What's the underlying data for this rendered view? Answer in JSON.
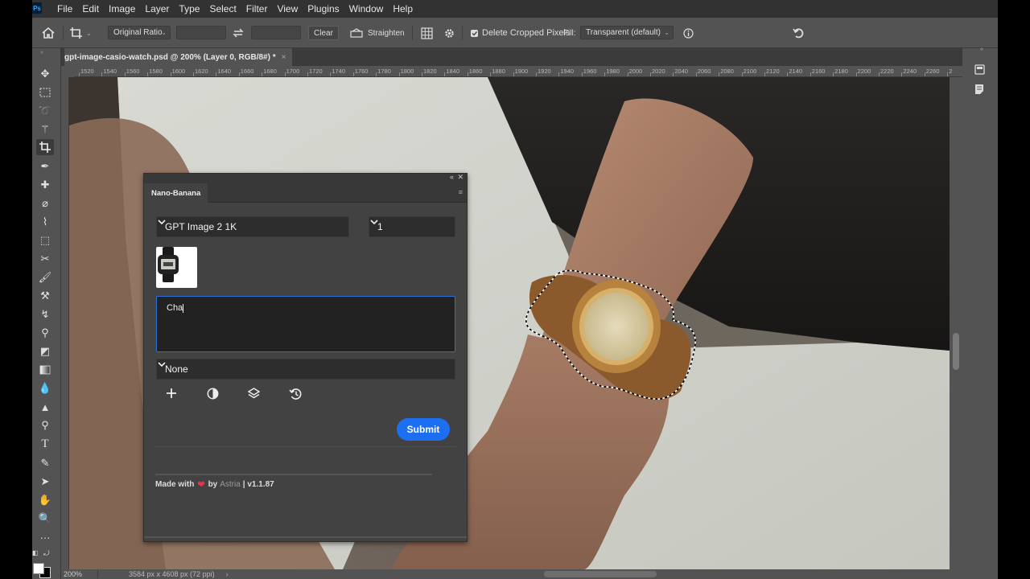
{
  "app": {
    "logo": "Ps",
    "menu": [
      "File",
      "Edit",
      "Image",
      "Layer",
      "Type",
      "Select",
      "Filter",
      "View",
      "Plugins",
      "Window",
      "Help"
    ]
  },
  "options_bar": {
    "ratio": "Original Ratio",
    "clear_label": "Clear",
    "straighten_label": "Straighten",
    "delete_cropped_label": "Delete Cropped Pixels",
    "delete_cropped_checked": true,
    "fill_label": "Fill:",
    "fill_value": "Transparent (default)"
  },
  "document": {
    "tab_title": "gpt-image-casio-watch.psd @ 200% (Layer 0, RGB/8#) *",
    "close_glyph": "×"
  },
  "ruler": {
    "ticks": [
      "1520",
      "1540",
      "1560",
      "1580",
      "1600",
      "1620",
      "1640",
      "1660",
      "1680",
      "1700",
      "1720",
      "1740",
      "1760",
      "1780",
      "1800",
      "1820",
      "1840",
      "1860",
      "1880",
      "1900",
      "1920",
      "1940",
      "1960",
      "1980",
      "2000",
      "2020",
      "2040",
      "2060",
      "2080",
      "2100",
      "2120",
      "2140",
      "2160",
      "2180",
      "2200",
      "2220",
      "2240",
      "2260",
      "2"
    ]
  },
  "status": {
    "zoom": "200%",
    "doc_info": "3584 px x 4608 px (72 ppi)"
  },
  "plugin": {
    "tab": "Nano-Banana",
    "model": "GPT Image 2 1K",
    "count": "1",
    "prompt_text": "Cha",
    "style": "None",
    "submit": "Submit",
    "footer": {
      "made_with": "Made with",
      "by": "by",
      "brand": "Astria",
      "version": "| v1.1.87"
    }
  },
  "colors": {
    "accent": "#1d6ff2",
    "focus": "#2d6fd6",
    "heart": "#e8334a"
  }
}
